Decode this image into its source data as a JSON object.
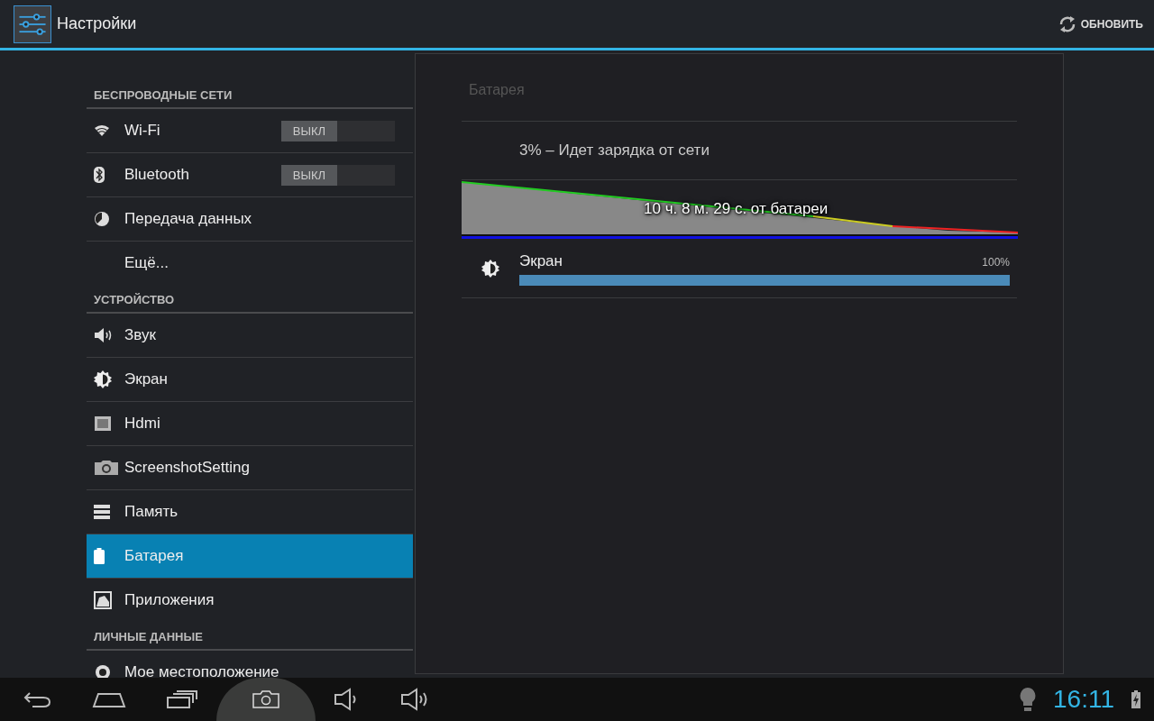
{
  "action_bar": {
    "title": "Настройки",
    "refresh_label": "ОБНОВИТЬ"
  },
  "sidebar": {
    "sections": [
      {
        "header": "БЕСПРОВОДНЫЕ СЕТИ",
        "items": [
          {
            "label": "Wi-Fi",
            "kind": "wifi",
            "selected": false,
            "toggle": {
              "label": "ВЫКЛ",
              "on": false
            }
          },
          {
            "label": "Bluetooth",
            "kind": "bluetooth",
            "selected": false,
            "toggle": {
              "label": "ВЫКЛ",
              "on": false
            }
          },
          {
            "label": "Передача данных",
            "kind": "data",
            "selected": false
          },
          {
            "label": "Ещё...",
            "kind": "plain",
            "selected": false
          }
        ]
      },
      {
        "header": "УСТРОЙСТВО",
        "items": [
          {
            "label": "Звук",
            "kind": "sound",
            "selected": false
          },
          {
            "label": "Экран",
            "kind": "brightness",
            "selected": false
          },
          {
            "label": "Hdmi",
            "kind": "hdmi",
            "selected": false
          },
          {
            "label": "ScreenshotSetting",
            "kind": "camera",
            "selected": false
          },
          {
            "label": "Память",
            "kind": "storage",
            "selected": false
          },
          {
            "label": "Батарея",
            "kind": "battery",
            "selected": true
          },
          {
            "label": "Приложения",
            "kind": "apps",
            "selected": false
          }
        ]
      },
      {
        "header": "ЛИЧНЫЕ ДАННЫЕ",
        "items": [
          {
            "label": "Мое местоположение",
            "kind": "location",
            "selected": false
          }
        ]
      }
    ]
  },
  "battery_panel": {
    "title": "Батарея",
    "status": "3% – Идет зарядка от сети",
    "graph_label": "10 ч. 8 м. 29 с. от батареи",
    "usage": [
      {
        "label": "Экран",
        "kind": "brightness",
        "reading": "100%",
        "level": 1.0
      }
    ]
  },
  "nav_bar": {
    "time": "16:11"
  }
}
